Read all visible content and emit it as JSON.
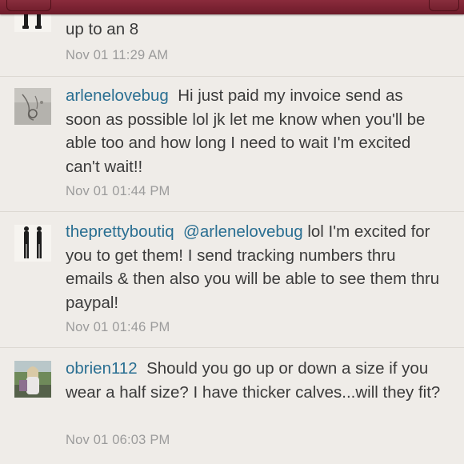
{
  "partial_comment": {
    "cut_text": "up to an 8",
    "timestamp": "Nov 01 11:29 AM"
  },
  "comments": [
    {
      "username": "arlenelovebug",
      "text": "Hi just paid my invoice send as soon as possible lol jk let me know when you'll be able too and how long I need to wait I'm excited can't wait!!",
      "timestamp": "Nov 01 01:44 PM"
    },
    {
      "username": "theprettyboutiq",
      "mention": "@arlenelovebug",
      "text": "lol I'm excited for you to get them! I send tracking numbers thru emails & then also you will be able to see them thru paypal!",
      "timestamp": "Nov 01 01:46 PM"
    },
    {
      "username": "obrien112",
      "text": "Should you go up or down a size if you wear a half size? I have thicker calves...will they fit?",
      "timestamp": "Nov 01 06:03 PM"
    }
  ]
}
